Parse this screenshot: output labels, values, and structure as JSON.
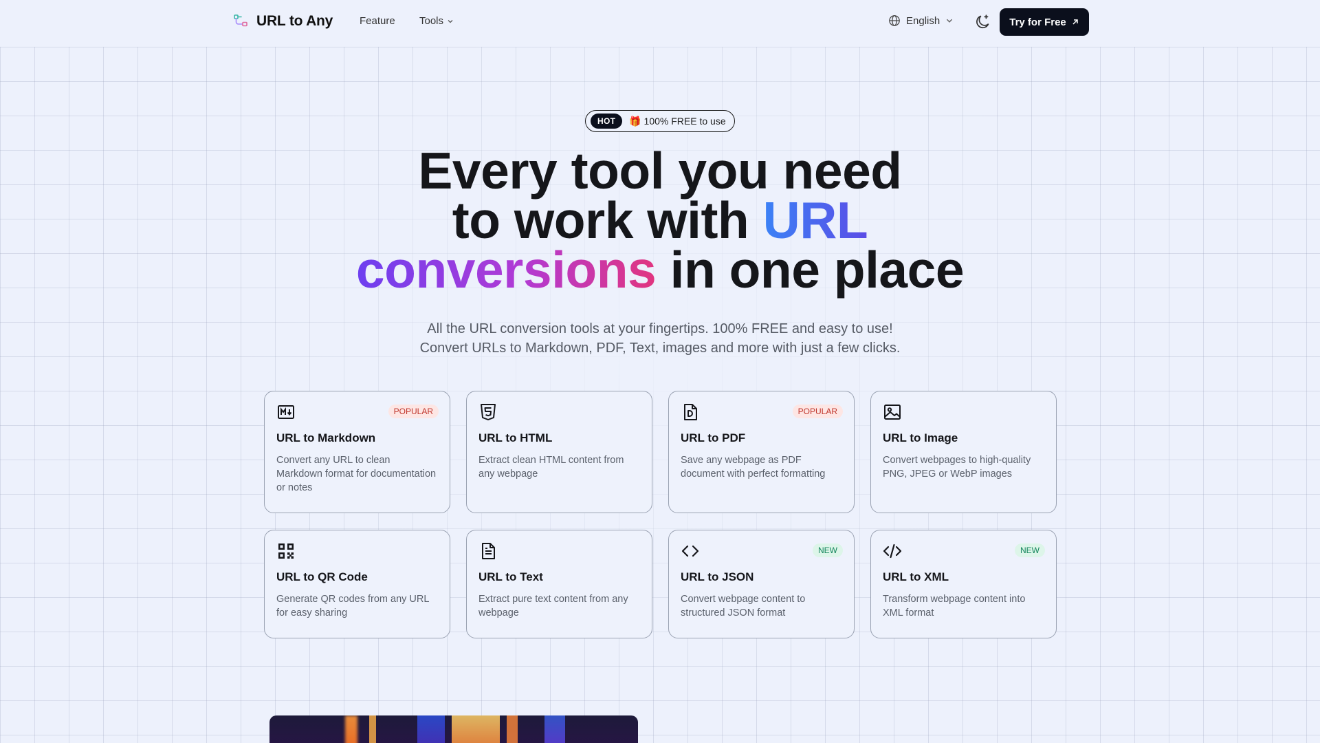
{
  "nav": {
    "logo_text": "URL to Any",
    "links": [
      {
        "label": "Feature"
      },
      {
        "label": "Tools"
      }
    ],
    "language": "English",
    "cta_label": "Try for Free"
  },
  "hero": {
    "badge": "HOT",
    "badge_text": "🎁 100% FREE to use",
    "headline_line1": "Every tool you need",
    "headline_line2_plain": "to work with ",
    "headline_line2_accent": "URL",
    "headline_line3_accent": "conversions",
    "headline_line3_plain": " in one place",
    "subtitle_line1": "All the URL conversion tools at your fingertips. 100% FREE and easy to use!",
    "subtitle_line2": "Convert URLs to Markdown, PDF, Text, images and more with just a few clicks."
  },
  "tools": [
    {
      "title": "URL to Markdown",
      "desc": "Convert any URL to clean Markdown format for documentation or notes",
      "badge": "POPULAR",
      "icon": "markdown-icon"
    },
    {
      "title": "URL to HTML",
      "desc": "Extract clean HTML content from any webpage",
      "badge": "",
      "icon": "html5-icon"
    },
    {
      "title": "URL to PDF",
      "desc": "Save any webpage as PDF document with perfect formatting",
      "badge": "POPULAR",
      "icon": "pdf-file-icon"
    },
    {
      "title": "URL to Image",
      "desc": "Convert webpages to high-quality PNG, JPEG or WebP images",
      "badge": "",
      "icon": "image-icon"
    },
    {
      "title": "URL to QR Code",
      "desc": "Generate QR codes from any URL for easy sharing",
      "badge": "",
      "icon": "qr-code-icon"
    },
    {
      "title": "URL to Text",
      "desc": "Extract pure text content from any webpage",
      "badge": "",
      "icon": "text-file-icon"
    },
    {
      "title": "URL to JSON",
      "desc": "Convert webpage content to structured JSON format",
      "badge": "NEW",
      "icon": "code-brackets-icon"
    },
    {
      "title": "URL to XML",
      "desc": "Transform webpage content into XML format",
      "badge": "NEW",
      "icon": "code-slash-icon"
    }
  ],
  "colors": {
    "background": "#edf1fc",
    "cta_bg": "#0b0f1c",
    "accent_blue": "#3b82f6",
    "accent_purple": "#6d3ff0",
    "accent_pink": "#e1357f",
    "popular_badge": "#c0352b",
    "new_badge": "#11845a"
  }
}
